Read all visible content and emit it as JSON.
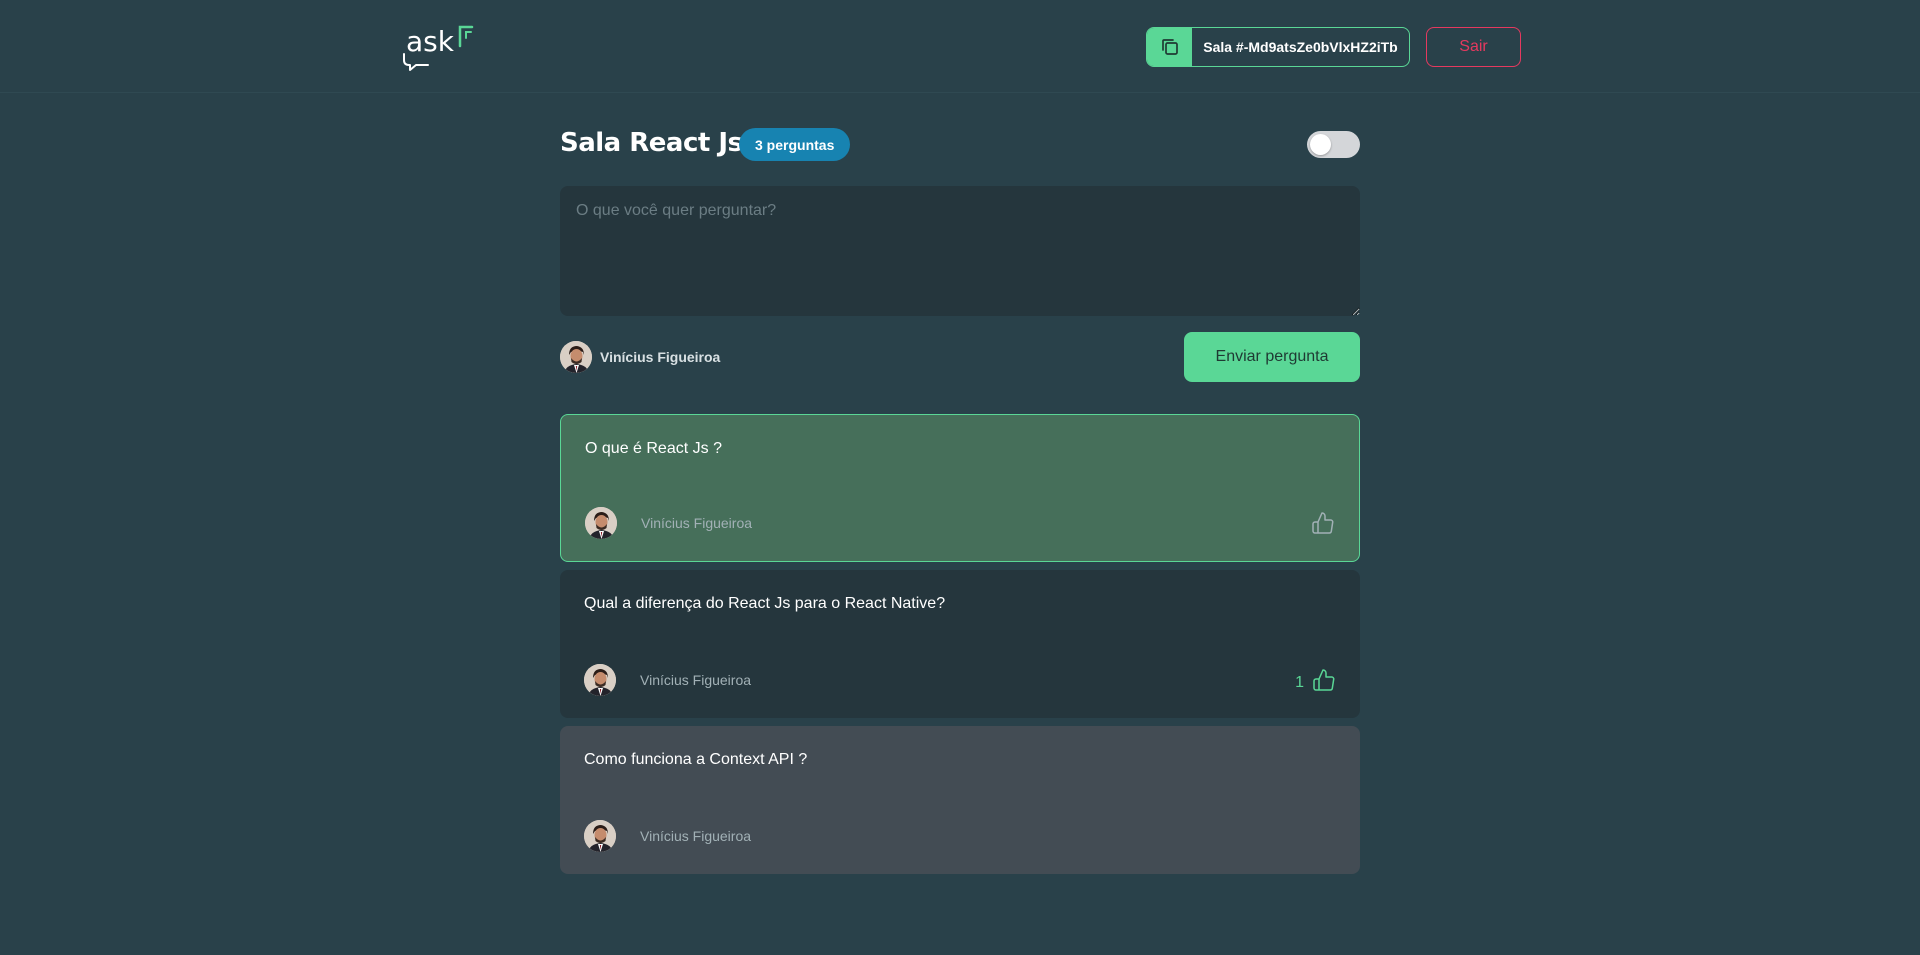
{
  "header": {
    "logo_text": "ask",
    "room_code_label": "Sala #-Md9atsZe0bVlxHZ2iTb",
    "leave_label": "Sair"
  },
  "room": {
    "title": "Sala React Js",
    "count_badge": "3 perguntas"
  },
  "form": {
    "placeholder": "O que você quer perguntar?",
    "user_name": "Vinícius Figueiroa",
    "send_label": "Enviar pergunta"
  },
  "questions": [
    {
      "text": "O que é React Js ?",
      "author": "Vinícius Figueiroa",
      "likes": "",
      "state": "highlighted"
    },
    {
      "text": "Qual a diferença do React Js para o React Native?",
      "author": "Vinícius Figueiroa",
      "likes": "1",
      "state": "normal"
    },
    {
      "text": "Como funciona a Context API ?",
      "author": "Vinícius Figueiroa",
      "likes": "",
      "state": "answered"
    }
  ],
  "colors": {
    "background": "#29414a",
    "accent_green": "#5ad796",
    "danger": "#e5395f",
    "badge_blue": "#1783b1",
    "highlight_bg": "#466f5a",
    "answered_bg": "#434c54"
  },
  "icons": [
    "logo-icon",
    "copy-icon",
    "like-icon"
  ]
}
